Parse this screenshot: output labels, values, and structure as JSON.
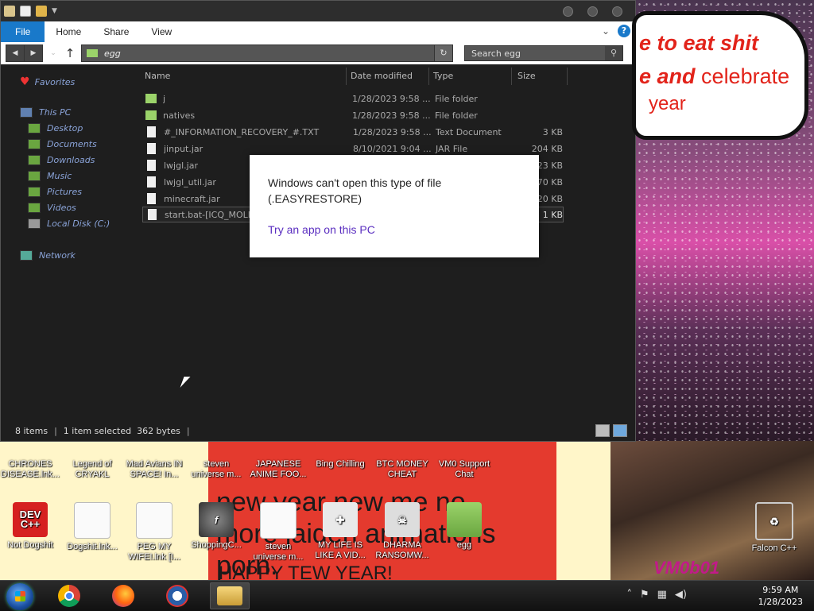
{
  "window": {
    "ribbon_tabs": [
      "File",
      "Home",
      "Share",
      "View"
    ],
    "address": "egg",
    "search_placeholder": "Search egg"
  },
  "navpane": {
    "favorites": "Favorites",
    "this_pc": "This PC",
    "pc_items": [
      "Desktop",
      "Documents",
      "Downloads",
      "Music",
      "Pictures",
      "Videos",
      "Local Disk (C:)"
    ],
    "network": "Network"
  },
  "columns": [
    "Name",
    "Date modified",
    "Type",
    "Size"
  ],
  "files": [
    {
      "name": "j",
      "date": "1/28/2023 9:58 ...",
      "type": "File folder",
      "size": "",
      "icon": "folder-icon"
    },
    {
      "name": "natives",
      "date": "1/28/2023 9:58 ...",
      "type": "File folder",
      "size": "",
      "icon": "folder-icon"
    },
    {
      "name": "#_INFORMATION_RECOVERY_#.TXT",
      "date": "1/28/2023 9:58 ...",
      "type": "Text Document",
      "size": "3 KB",
      "icon": "document-icon"
    },
    {
      "name": "jinput.jar",
      "date": "8/10/2021 9:04 ...",
      "type": "JAR File",
      "size": "204 KB",
      "icon": "document-icon"
    },
    {
      "name": "lwjgl.jar",
      "date": "",
      "type": "",
      "size": "23 KB",
      "icon": "document-icon"
    },
    {
      "name": "lwjgl_util.jar",
      "date": "",
      "type": "",
      "size": "70 KB",
      "icon": "document-icon"
    },
    {
      "name": "minecraft.jar",
      "date": "",
      "type": "",
      "size": "20 KB",
      "icon": "document-icon"
    },
    {
      "name": "start.bat-[ICQ_MOLLY",
      "date": "",
      "type": "",
      "size": "1 KB",
      "icon": "document-icon"
    }
  ],
  "status": {
    "items": "8 items",
    "selected": "1 item selected  362 bytes"
  },
  "dialog": {
    "message": "Windows can't open this type of file (.EASYRESTORE)",
    "link": "Try an app on this PC"
  },
  "wallpaper": {
    "bubble_line1": "e to eat shit",
    "bubble_line2": "e and",
    "bubble_line2b": "celebrate",
    "bubble_line3": "year",
    "red_text": "new year new me no more jaiden animations porn.",
    "red_text2": "HAPPY TEW YEAR!",
    "corner_text": "VM0b01"
  },
  "desktop_icons_top": [
    {
      "label": "CHRONES DISEASE.lnk..."
    },
    {
      "label": "Legend of CRYAKL"
    },
    {
      "label": "Mad Avians IN SPACE! In..."
    },
    {
      "label": "steven universe m..."
    },
    {
      "label": "JAPANESE ANIME FOO..."
    },
    {
      "label": "Bing Chilling"
    },
    {
      "label": "BTC MONEY CHEAT"
    },
    {
      "label": "VM0 Support Chat"
    }
  ],
  "desktop_icons_bottom": [
    {
      "label": "Not Dogshit",
      "icon": "devcpp-icon",
      "glyph": "DEV C++"
    },
    {
      "label": "Dogshit.lnk...",
      "icon": "document-icon",
      "glyph": ""
    },
    {
      "label": "PEG MY WIFE!.lnk [I...",
      "icon": "document-icon",
      "glyph": ""
    },
    {
      "label": "ShoppingC...",
      "icon": "flash-icon",
      "glyph": "f"
    },
    {
      "label": "steven universe m...",
      "icon": "document-icon",
      "glyph": ""
    },
    {
      "label": "MY LIFE IS LIKE A VID...",
      "icon": "gamepad-icon",
      "glyph": "✚"
    },
    {
      "label": "DHARMA RANSOMW...",
      "icon": "skull-icon",
      "glyph": "☠"
    },
    {
      "label": "egg",
      "icon": "folder-icon",
      "glyph": ""
    },
    {
      "label": "Falcon C++",
      "icon": "recycle-bin-icon",
      "glyph": "♻"
    }
  ],
  "taskbar": {
    "time": "9:59 AM",
    "date": "1/28/2023"
  }
}
